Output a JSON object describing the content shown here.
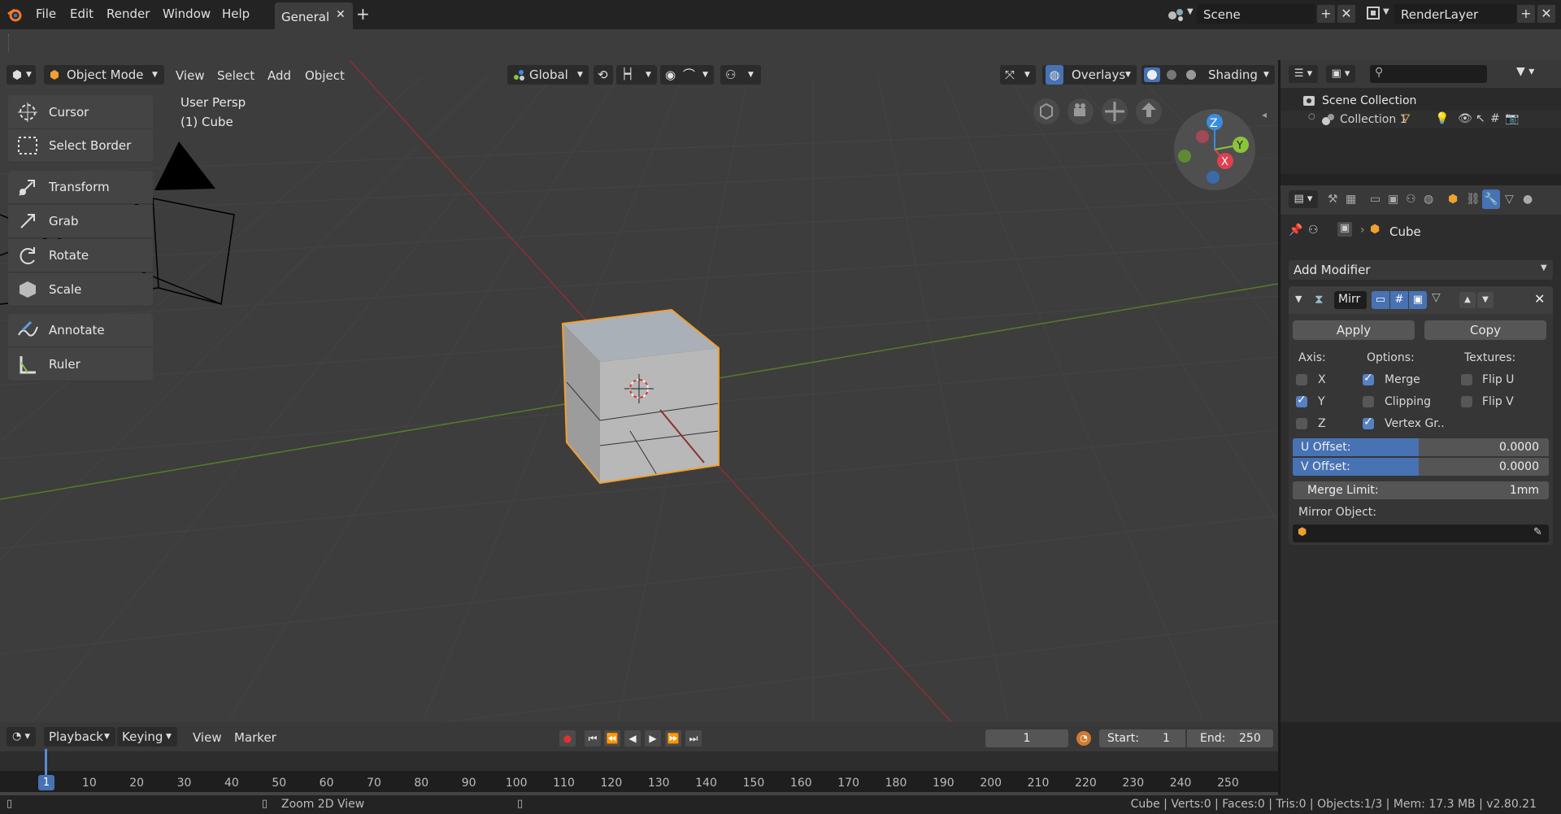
{
  "menubar": {
    "items": [
      "File",
      "Edit",
      "Render",
      "Window",
      "Help"
    ],
    "workspace_tab": "General",
    "scene_label": "Scene",
    "render_layer": "RenderLayer"
  },
  "viewport_header": {
    "mode": "Object Mode",
    "menus": [
      "View",
      "Select",
      "Add",
      "Object"
    ],
    "orientation": "Global",
    "overlays": "Overlays",
    "shading": "Shading"
  },
  "viewport": {
    "view_name": "User Persp",
    "active_object": "(1) Cube",
    "gizmo_axes": [
      "Z",
      "Y",
      "X"
    ]
  },
  "toolbar": {
    "tools": [
      "Cursor",
      "Select Border",
      "Transform",
      "Grab",
      "Rotate",
      "Scale",
      "Annotate",
      "Ruler"
    ]
  },
  "outliner": {
    "root": "Scene Collection",
    "collection": "Collection 1"
  },
  "properties": {
    "object_name": "Cube",
    "add_modifier": "Add Modifier",
    "modifier_name": "Mirr",
    "apply": "Apply",
    "copy": "Copy",
    "axis_label": "Axis:",
    "options_label": "Options:",
    "textures_label": "Textures:",
    "axes": [
      {
        "label": "X",
        "on": false
      },
      {
        "label": "Y",
        "on": true
      },
      {
        "label": "Z",
        "on": false
      }
    ],
    "options": [
      {
        "label": "Merge",
        "on": true
      },
      {
        "label": "Clipping",
        "on": false
      },
      {
        "label": "Vertex Gr..",
        "on": true
      }
    ],
    "textures": [
      {
        "label": "Flip U",
        "on": false
      },
      {
        "label": "Flip V",
        "on": false
      }
    ],
    "u_offset_label": "U Offset:",
    "u_offset_value": "0.0000",
    "v_offset_label": "V Offset:",
    "v_offset_value": "0.0000",
    "merge_limit_label": "Merge Limit:",
    "merge_limit_value": "1mm",
    "mirror_object_label": "Mirror Object:"
  },
  "timeline": {
    "menus": [
      "Playback",
      "Keying",
      "View",
      "Marker"
    ],
    "current_frame": "1",
    "start_label": "Start:",
    "start_value": "1",
    "end_label": "End:",
    "end_value": "250",
    "ruler_ticks": [
      "1",
      "10",
      "20",
      "30",
      "40",
      "50",
      "60",
      "70",
      "80",
      "90",
      "100",
      "110",
      "120",
      "130",
      "140",
      "150",
      "160",
      "170",
      "180",
      "190",
      "200",
      "210",
      "220",
      "230",
      "240",
      "250"
    ]
  },
  "statusbar": {
    "hint": "Zoom 2D View",
    "stats": "Cube | Verts:0 | Faces:0 | Tris:0 | Objects:1/3 | Mem: 17.3 MB | v2.80.21"
  },
  "colors": {
    "accent": "#4772b3",
    "selection_outline": "#f0a030",
    "x_axis": "#e04050",
    "y_axis": "#8ac43a",
    "z_axis": "#3a8ce0"
  }
}
